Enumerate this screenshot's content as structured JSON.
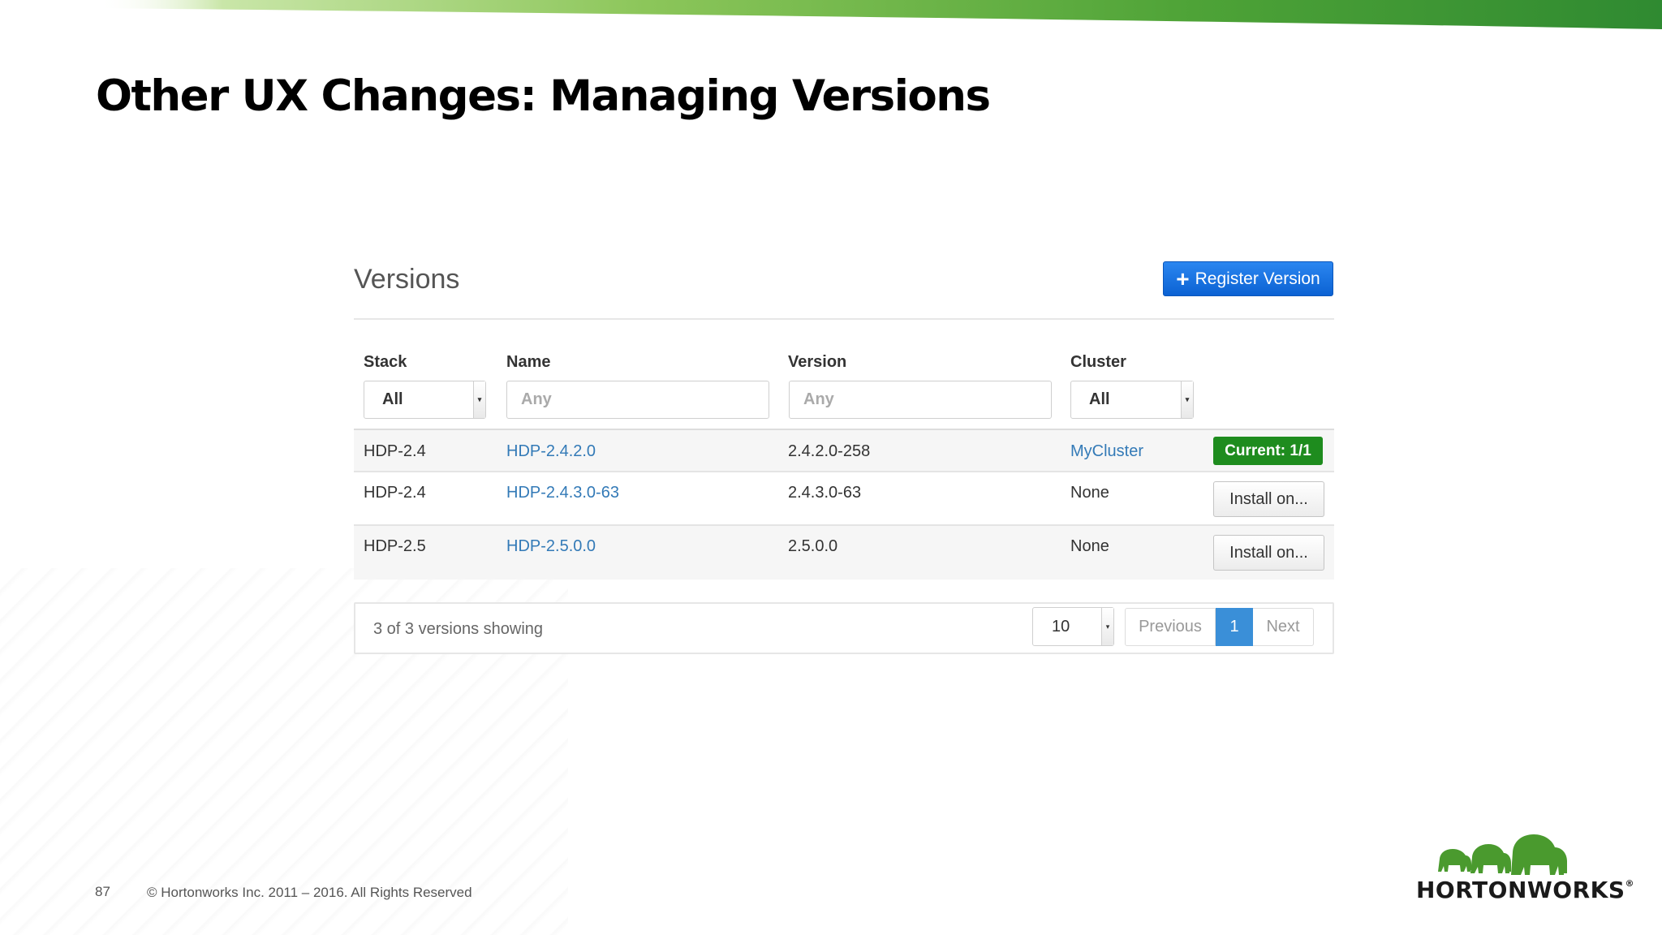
{
  "slide": {
    "title": "Other UX Changes: Managing Versions",
    "page_number": "87",
    "copyright": "© Hortonworks Inc. 2011 – 2016. All Rights Reserved",
    "logo_text": "HORTONWORKS",
    "logo_mark": "®"
  },
  "versions_panel": {
    "heading": "Versions",
    "register_button": "Register Version",
    "columns": {
      "stack": "Stack",
      "name": "Name",
      "version": "Version",
      "cluster": "Cluster"
    },
    "filters": {
      "stack": "All",
      "name_placeholder": "Any",
      "version_placeholder": "Any",
      "cluster": "All"
    },
    "rows": [
      {
        "stack": "HDP-2.4",
        "name": "HDP-2.4.2.0",
        "version": "2.4.2.0-258",
        "cluster": "MyCluster",
        "action": "Current: 1/1"
      },
      {
        "stack": "HDP-2.4",
        "name": "HDP-2.4.3.0-63",
        "version": "2.4.3.0-63",
        "cluster": "None",
        "action": "Install on..."
      },
      {
        "stack": "HDP-2.5",
        "name": "HDP-2.5.0.0",
        "version": "2.5.0.0",
        "cluster": "None",
        "action": "Install on..."
      }
    ],
    "footer": {
      "showing": "3 of 3 versions showing",
      "page_size": "10",
      "previous": "Previous",
      "current_page": "1",
      "next": "Next"
    }
  },
  "colors": {
    "accent_blue": "#1a73e8",
    "link_blue": "#337ab7",
    "current_green": "#1e8c1e",
    "brand_green": "#4a9a2e"
  },
  "icons": {
    "register": "plus-icon",
    "select_caret": "caret-down-icon",
    "logo": "elephants-logo-icon"
  }
}
